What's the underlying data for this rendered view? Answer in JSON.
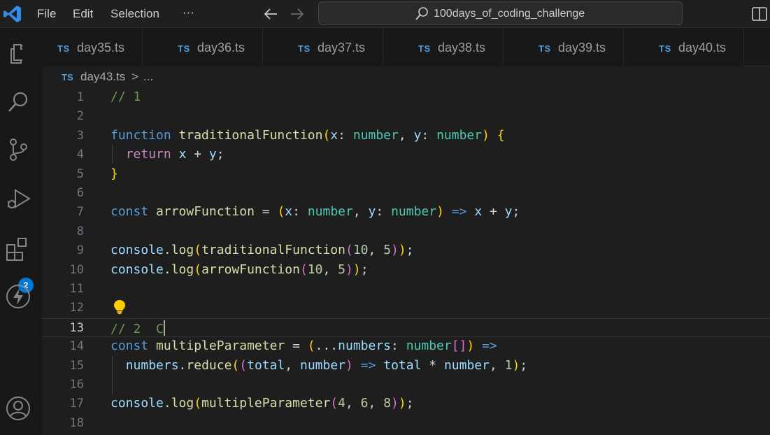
{
  "menu": {
    "file": "File",
    "edit": "Edit",
    "selection": "Selection",
    "more": "···"
  },
  "search": {
    "text": "100days_of_coding_challenge"
  },
  "activity": {
    "extensions_badge": "2"
  },
  "tabs": [
    {
      "lang": "TS",
      "label": "day35.ts"
    },
    {
      "lang": "TS",
      "label": "day36.ts"
    },
    {
      "lang": "TS",
      "label": "day37.ts"
    },
    {
      "lang": "TS",
      "label": "day38.ts"
    },
    {
      "lang": "TS",
      "label": "day39.ts"
    },
    {
      "lang": "TS",
      "label": "day40.ts"
    }
  ],
  "breadcrumb": {
    "lang": "TS",
    "file": "day43.ts",
    "separator": ">",
    "more": "..."
  },
  "editor": {
    "current_line": 13,
    "lines": [
      {
        "n": "1",
        "tokens": [
          [
            "cmt",
            "// 1"
          ]
        ]
      },
      {
        "n": "2",
        "tokens": []
      },
      {
        "n": "3",
        "tokens": [
          [
            "kw",
            "function"
          ],
          [
            "plain",
            " "
          ],
          [
            "fn",
            "traditionalFunction"
          ],
          [
            "br1",
            "("
          ],
          [
            "var",
            "x"
          ],
          [
            "plain",
            ": "
          ],
          [
            "type",
            "number"
          ],
          [
            "plain",
            ", "
          ],
          [
            "var",
            "y"
          ],
          [
            "plain",
            ": "
          ],
          [
            "type",
            "number"
          ],
          [
            "br1",
            ")"
          ],
          [
            "plain",
            " "
          ],
          [
            "br1",
            "{"
          ]
        ]
      },
      {
        "n": "4",
        "tokens": [
          [
            "plain",
            "  "
          ],
          [
            "kwc",
            "return"
          ],
          [
            "plain",
            " "
          ],
          [
            "var",
            "x"
          ],
          [
            "plain",
            " + "
          ],
          [
            "var",
            "y"
          ],
          [
            "plain",
            ";"
          ]
        ]
      },
      {
        "n": "5",
        "tokens": [
          [
            "br1",
            "}"
          ]
        ]
      },
      {
        "n": "6",
        "tokens": []
      },
      {
        "n": "7",
        "tokens": [
          [
            "kw",
            "const"
          ],
          [
            "plain",
            " "
          ],
          [
            "fn",
            "arrowFunction"
          ],
          [
            "plain",
            " = "
          ],
          [
            "br1",
            "("
          ],
          [
            "var",
            "x"
          ],
          [
            "plain",
            ": "
          ],
          [
            "type",
            "number"
          ],
          [
            "plain",
            ", "
          ],
          [
            "var",
            "y"
          ],
          [
            "plain",
            ": "
          ],
          [
            "type",
            "number"
          ],
          [
            "br1",
            ")"
          ],
          [
            "plain",
            " "
          ],
          [
            "kw",
            "=>"
          ],
          [
            "plain",
            " "
          ],
          [
            "var",
            "x"
          ],
          [
            "plain",
            " + "
          ],
          [
            "var",
            "y"
          ],
          [
            "plain",
            ";"
          ]
        ]
      },
      {
        "n": "8",
        "tokens": []
      },
      {
        "n": "9",
        "tokens": [
          [
            "var",
            "console"
          ],
          [
            "plain",
            "."
          ],
          [
            "fn",
            "log"
          ],
          [
            "br1",
            "("
          ],
          [
            "fn",
            "traditionalFunction"
          ],
          [
            "br2",
            "("
          ],
          [
            "num",
            "10"
          ],
          [
            "plain",
            ", "
          ],
          [
            "num",
            "5"
          ],
          [
            "br2",
            ")"
          ],
          [
            "br1",
            ")"
          ],
          [
            "plain",
            ";"
          ]
        ]
      },
      {
        "n": "10",
        "tokens": [
          [
            "var",
            "console"
          ],
          [
            "plain",
            "."
          ],
          [
            "fn",
            "log"
          ],
          [
            "br1",
            "("
          ],
          [
            "fn",
            "arrowFunction"
          ],
          [
            "br2",
            "("
          ],
          [
            "num",
            "10"
          ],
          [
            "plain",
            ", "
          ],
          [
            "num",
            "5"
          ],
          [
            "br2",
            ")"
          ],
          [
            "br1",
            ")"
          ],
          [
            "plain",
            ";"
          ]
        ]
      },
      {
        "n": "11",
        "tokens": []
      },
      {
        "n": "12",
        "tokens": []
      },
      {
        "n": "13",
        "tokens": [
          [
            "cmt",
            "// 2  C"
          ]
        ]
      },
      {
        "n": "14",
        "tokens": [
          [
            "kw",
            "const"
          ],
          [
            "plain",
            " "
          ],
          [
            "fn",
            "multipleParameter"
          ],
          [
            "plain",
            " = "
          ],
          [
            "br1",
            "("
          ],
          [
            "plain",
            "..."
          ],
          [
            "var",
            "numbers"
          ],
          [
            "plain",
            ": "
          ],
          [
            "type",
            "number"
          ],
          [
            "br2",
            "[]"
          ],
          [
            "br1",
            ")"
          ],
          [
            "plain",
            " "
          ],
          [
            "kw",
            "=>"
          ]
        ]
      },
      {
        "n": "15",
        "tokens": [
          [
            "plain",
            "  "
          ],
          [
            "var",
            "numbers"
          ],
          [
            "plain",
            "."
          ],
          [
            "fn",
            "reduce"
          ],
          [
            "br1",
            "("
          ],
          [
            "br2",
            "("
          ],
          [
            "var",
            "total"
          ],
          [
            "plain",
            ", "
          ],
          [
            "var",
            "number"
          ],
          [
            "br2",
            ")"
          ],
          [
            "plain",
            " "
          ],
          [
            "kw",
            "=>"
          ],
          [
            "plain",
            " "
          ],
          [
            "var",
            "total"
          ],
          [
            "plain",
            " * "
          ],
          [
            "var",
            "number"
          ],
          [
            "plain",
            ", "
          ],
          [
            "num",
            "1"
          ],
          [
            "br1",
            ")"
          ],
          [
            "plain",
            ";"
          ]
        ]
      },
      {
        "n": "16",
        "tokens": []
      },
      {
        "n": "17",
        "tokens": [
          [
            "var",
            "console"
          ],
          [
            "plain",
            "."
          ],
          [
            "fn",
            "log"
          ],
          [
            "br1",
            "("
          ],
          [
            "fn",
            "multipleParameter"
          ],
          [
            "br2",
            "("
          ],
          [
            "num",
            "4"
          ],
          [
            "plain",
            ", "
          ],
          [
            "num",
            "6"
          ],
          [
            "plain",
            ", "
          ],
          [
            "num",
            "8"
          ],
          [
            "br2",
            ")"
          ],
          [
            "br1",
            ")"
          ],
          [
            "plain",
            ";"
          ]
        ]
      },
      {
        "n": "18",
        "tokens": []
      }
    ]
  }
}
